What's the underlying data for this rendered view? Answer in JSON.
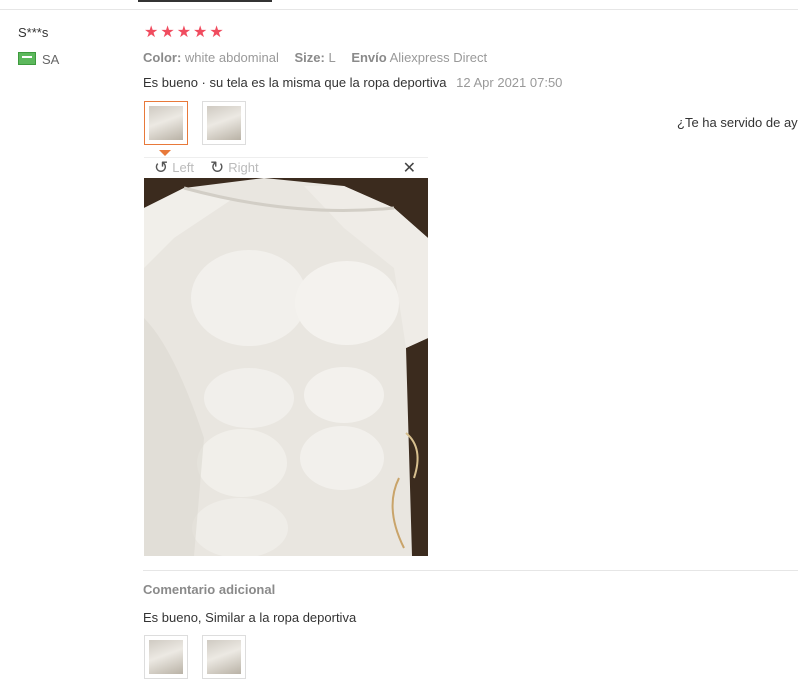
{
  "review": {
    "user_name": "S***s",
    "country": "SA",
    "rating": 5,
    "attributes": [
      {
        "key": "Color:",
        "value": "white abdominal"
      },
      {
        "key": "Size:",
        "value": "L"
      },
      {
        "key": "Envío",
        "value": "Aliexpress Direct"
      }
    ],
    "text": "Es bueno · su tela es la misma que la ropa deportiva",
    "date": "12 Apr 2021 07:50"
  },
  "helpful_prompt": "¿Te ha servido de ay",
  "viewer": {
    "left_label": "Left",
    "right_label": "Right"
  },
  "additional": {
    "title": "Comentario adicional",
    "text": "Es bueno, Similar a la ropa deportiva"
  },
  "colors": {
    "star": "#f04c5f",
    "active_thumb_border": "#e8793a"
  }
}
